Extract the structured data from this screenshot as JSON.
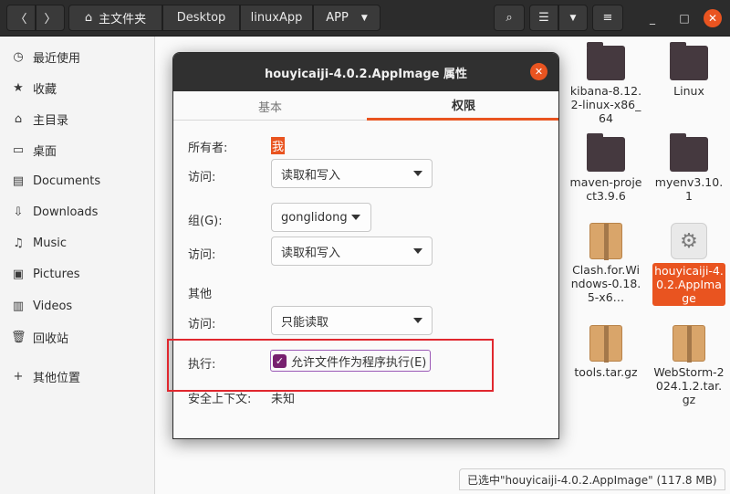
{
  "header": {
    "back_icon": "chevron-left-icon",
    "forward_icon": "chevron-right-icon",
    "breadcrumbs": [
      "主文件夹",
      "Desktop",
      "linuxApp",
      "APP"
    ],
    "home_icon": "home-icon",
    "search_icon": "search-icon",
    "view_icon": "list-view-icon",
    "menu_icon": "hamburger-icon",
    "min_label": "_",
    "max_label": "□",
    "close_label": "✕"
  },
  "sidebar": {
    "items": [
      {
        "icon": "clock-icon",
        "glyph": "◷",
        "label": "最近使用"
      },
      {
        "icon": "star-icon",
        "glyph": "★",
        "label": "收藏"
      },
      {
        "icon": "home-icon",
        "glyph": "⌂",
        "label": "主目录"
      },
      {
        "icon": "desktop-icon",
        "glyph": "▭",
        "label": "桌面"
      },
      {
        "icon": "document-icon",
        "glyph": "▤",
        "label": "Documents"
      },
      {
        "icon": "download-icon",
        "glyph": "⇩",
        "label": "Downloads"
      },
      {
        "icon": "music-icon",
        "glyph": "♫",
        "label": "Music"
      },
      {
        "icon": "picture-icon",
        "glyph": "▣",
        "label": "Pictures"
      },
      {
        "icon": "video-icon",
        "glyph": "▥",
        "label": "Videos"
      },
      {
        "icon": "trash-icon",
        "glyph": "🗑",
        "label": "回收站"
      },
      {
        "icon": "plus-icon",
        "glyph": "+",
        "label": "其他位置"
      }
    ]
  },
  "files": [
    {
      "name": "kibana-8.12.2-linux-x86_64",
      "type": "folder"
    },
    {
      "name": "Linux",
      "type": "folder"
    },
    {
      "name": "maven-project3.9.6",
      "type": "folder"
    },
    {
      "name": "myenv3.10.1",
      "type": "folder"
    },
    {
      "name": "Clash.for.Windows-0.18.5-x6…",
      "type": "package"
    },
    {
      "name": "houyicaiji-4.0.2.AppImage",
      "type": "appimage"
    },
    {
      "name": "tools.tar.gz",
      "type": "package"
    },
    {
      "name": "WebStorm-2024.1.2.tar.gz",
      "type": "package"
    }
  ],
  "status": {
    "text": "已选中\"houyicaiji-4.0.2.AppImage\" (117.8 MB)"
  },
  "dialog": {
    "title": "houyicaiji-4.0.2.AppImage 属性",
    "tabs": [
      "基本",
      "权限"
    ],
    "owner_label": "所有者:",
    "owner_value": "我",
    "owner_access_label": "访问:",
    "owner_access_value": "读取和写入",
    "group_label": "组(G):",
    "group_value": "gonglidong",
    "group_access_label": "访问:",
    "group_access_value": "读取和写入",
    "others_label": "其他",
    "others_access_label": "访问:",
    "others_access_value": "只能读取",
    "exec_label": "执行:",
    "exec_checkbox": "允许文件作为程序执行(E)",
    "exec_checked": true,
    "context_label": "安全上下文:",
    "context_value": "未知"
  }
}
